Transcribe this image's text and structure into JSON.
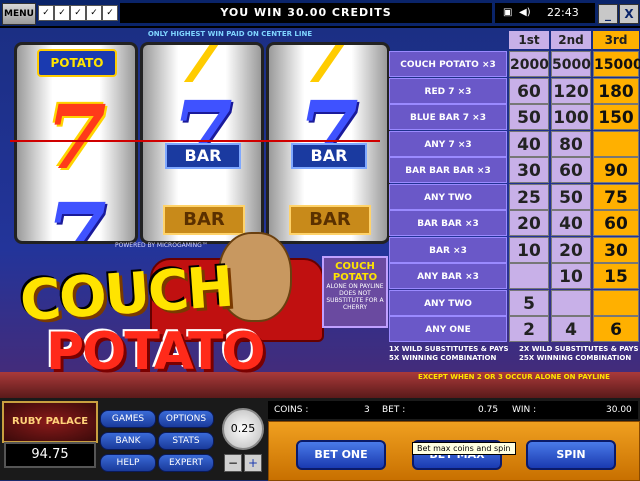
{
  "topbar": {
    "menu_label": "MENU",
    "message": "YOU WIN 30.00 CREDITS",
    "clock": "22:43",
    "minimize": "_",
    "close": "X",
    "tool_icons": [
      "checkbox-icon",
      "checkbox-icon",
      "checkbox-icon",
      "checkbox-icon",
      "checkbox-icon"
    ]
  },
  "reels": {
    "center_line_note": "ONLY HIGHEST WIN PAID ON CENTER LINE",
    "reel1": {
      "top": "POTATO",
      "center": "7",
      "bottom": "7"
    },
    "reel2": {
      "top": "7",
      "center": "BAR",
      "bottom": "BAR"
    },
    "reel3": {
      "top": "7",
      "center": "BAR",
      "bottom": "BAR"
    },
    "powered_by": "POWERED BY MICROGAMING™"
  },
  "logo": {
    "line1": "COUCH",
    "line2": "POTATO"
  },
  "couch_note": {
    "title": "COUCH POTATO",
    "text": "ALONE ON PAYLINE DOES NOT SUBSTITUTE FOR A CHERRY"
  },
  "paytable": {
    "headers": [
      "1st",
      "2nd",
      "3rd"
    ],
    "rows": [
      {
        "symbol": "COUCH POTATO ×3",
        "p1": "2000",
        "p2": "5000",
        "p3": "15000"
      },
      {
        "symbol": "RED 7 ×3",
        "p1": "60",
        "p2": "120",
        "p3": "180"
      },
      {
        "symbol": "BLUE BAR 7 ×3",
        "p1": "50",
        "p2": "100",
        "p3": "150"
      },
      {
        "symbol": "ANY 7 ×3",
        "p1": "40",
        "p2": "80",
        "p3": ""
      },
      {
        "symbol": "BAR BAR BAR ×3",
        "p1": "30",
        "p2": "60",
        "p3": "90"
      },
      {
        "symbol": "ANY TWO",
        "p1": "25",
        "p2": "50",
        "p3": "75"
      },
      {
        "symbol": "BAR BAR ×3",
        "p1": "20",
        "p2": "40",
        "p3": "60"
      },
      {
        "symbol": "BAR ×3",
        "p1": "10",
        "p2": "20",
        "p3": "30"
      },
      {
        "symbol": "ANY BAR ×3",
        "p1": "",
        "p2": "10",
        "p3": "15"
      },
      {
        "symbol": "ANY TWO",
        "p1": "5",
        "p2": "",
        "p3": ""
      },
      {
        "symbol": "ANY ONE",
        "p1": "2",
        "p2": "4",
        "p3": "6"
      }
    ],
    "wild1": "1X WILD SUBSTITUTES & PAYS 5X WINNING COMBINATION",
    "wild2": "2X WILD SUBSTITUTES & PAYS 25X WINNING COMBINATION",
    "except_note": "EXCEPT WHEN 2 OR 3 OCCUR ALONE ON PAYLINE"
  },
  "bottom": {
    "casino_logo": "RUBY PALACE",
    "balance": "94.75",
    "nav": [
      "GAMES",
      "OPTIONS",
      "BANK",
      "STATS",
      "HELP",
      "EXPERT"
    ],
    "coin_value": "0.25",
    "coin_minus": "−",
    "coin_plus": "+",
    "coins_label": "COINS :",
    "coins_value": "3",
    "bet_label": "BET :",
    "bet_value": "0.75",
    "win_label": "WIN :",
    "win_value": "30.00",
    "bet_one": "BET ONE",
    "bet_max": "BET MAX",
    "spin": "SPIN",
    "tooltip": "Bet max coins and spin"
  },
  "colors": {
    "payline": "#d00000",
    "third_column": "#ffb000",
    "accent_blue": "#1a3ab0"
  }
}
